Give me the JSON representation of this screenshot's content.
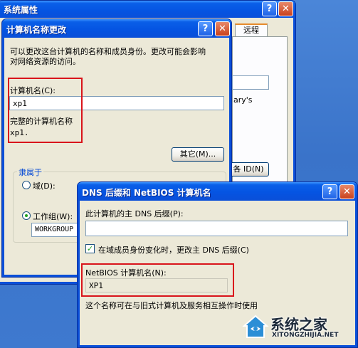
{
  "sys_props": {
    "title": "系统属性",
    "tab_remote": "远程",
    "right_partial_text": "ary's",
    "id_button_partial": "各 ID(N)"
  },
  "rename_dialog": {
    "title": "计算机名称更改",
    "description": [
      "可以更改这台计算机的名称和成员身份。更改可能会影响",
      "对网络资源的访问。"
    ],
    "computer_name_label": "计算机名(C):",
    "computer_name_value": "xp1",
    "full_name_label": "完整的计算机名称",
    "full_name_value": "xp1.",
    "more_button": "其它(M)...",
    "member_of_label": "隶属于",
    "domain_label": "域(D):",
    "workgroup_label": "工作组(W):",
    "workgroup_value": "WORKGROUP"
  },
  "dns_dialog": {
    "title": "DNS 后缀和 NetBIOS 计算机名",
    "primary_dns_label": "此计算机的主 DNS 后缀(P):",
    "primary_dns_value": "",
    "change_checkbox_label": "在域成员身份变化时，更改主 DNS 后缀(C)",
    "change_checkbox_checked": true,
    "netbios_label": "NetBIOS 计算机名(N):",
    "netbios_value": "XP1",
    "note": "这个名称可在与旧式计算机及服务相互操作时使用"
  },
  "watermark": {
    "brand": "系统之家",
    "url": "XITONGZHIJIA.NET"
  },
  "title_buttons": {
    "help": "?",
    "close": "✕"
  },
  "colors": {
    "title_bar": "#0a5fe8",
    "dialog_bg": "#ece9d8",
    "highlight_box": "#d9141b"
  }
}
